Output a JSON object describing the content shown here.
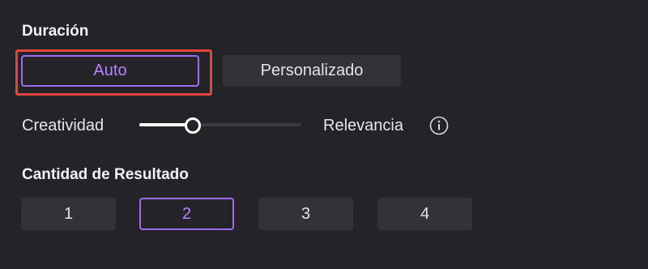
{
  "duration": {
    "title": "Duración",
    "options": [
      "Auto",
      "Personalizado"
    ],
    "selected": "Auto"
  },
  "slider": {
    "left_label": "Creatividad",
    "right_label": "Relevancia",
    "value": 0.33,
    "info_icon": "info-icon"
  },
  "results": {
    "title": "Cantidad de Resultado",
    "options": [
      "1",
      "2",
      "3",
      "4"
    ],
    "selected": "2"
  },
  "colors": {
    "background": "#242328",
    "accent": "#a06bf0",
    "highlight": "#e5443a",
    "button_bg": "#333238"
  }
}
